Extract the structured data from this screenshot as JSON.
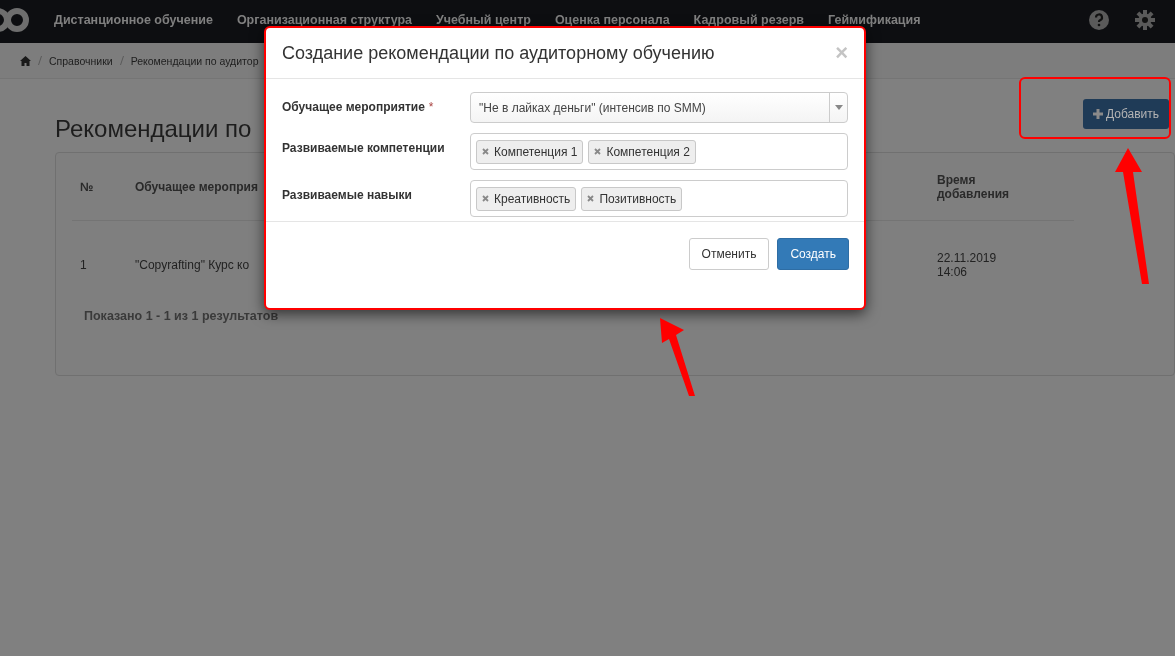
{
  "navbar": {
    "items": [
      "Дистанционное обучение",
      "Организационная структура",
      "Учебный центр",
      "Оценка персонала",
      "Кадровый резерв",
      "Геймификация"
    ]
  },
  "breadcrumbs": [
    "Справочники",
    "Рекомендации по аудитор"
  ],
  "page": {
    "title": "Рекомендации по",
    "add_button": "Добавить"
  },
  "table": {
    "columns": [
      "№",
      "Обучащее мероприя",
      "Время добавления"
    ],
    "rows": [
      {
        "cells": [
          "1",
          "\"Copyrafting\" Курс ко",
          "22.11.2019 14:06"
        ]
      }
    ],
    "summary": "Показано 1 - 1 из 1 результатов"
  },
  "modal": {
    "title": "Создание рекомендации по аудиторному обучению",
    "close": "×",
    "fields": [
      {
        "kind": "select",
        "label": "Обучащее мероприятие",
        "required_mark": "*",
        "value": "\"Не в лайках деньги\" (интенсив по SMM)"
      },
      {
        "kind": "tags",
        "label": "Развиваемые компетенции",
        "tags": [
          "Компетенция 1",
          "Компетенция 2"
        ]
      },
      {
        "kind": "tags",
        "label": "Развиваемые навыки",
        "tags": [
          "Креативность",
          "Позитивность"
        ]
      }
    ],
    "buttons": [
      {
        "label": "Отменить",
        "kind": "default"
      },
      {
        "label": "Создать",
        "kind": "primary"
      }
    ]
  }
}
